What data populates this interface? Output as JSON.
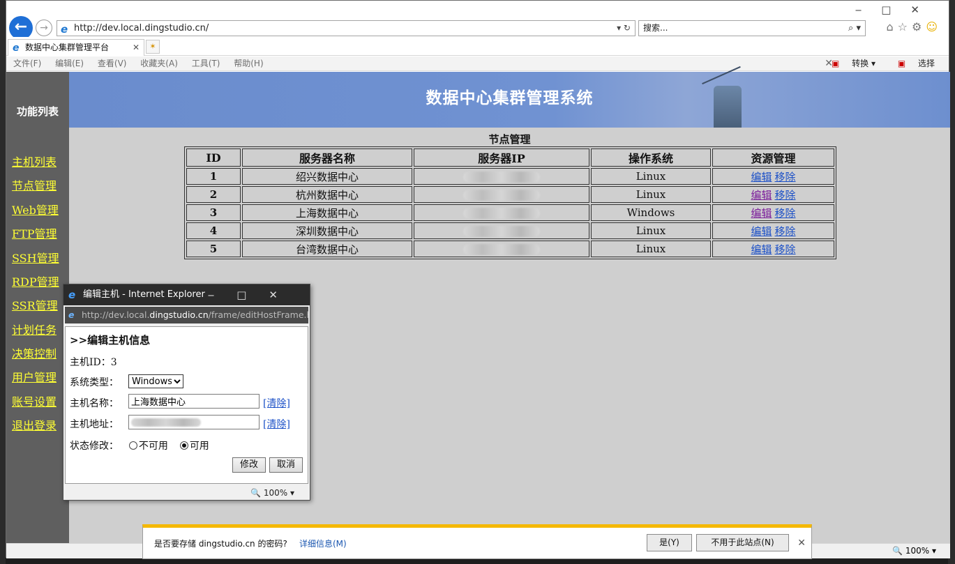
{
  "browser": {
    "url": "http://dev.local.dingstudio.cn/",
    "search_placeholder": "搜索...",
    "tab_title": "数据中心集群管理平台",
    "menu": [
      "文件(F)",
      "编辑(E)",
      "查看(V)",
      "收藏夹(A)",
      "工具(T)",
      "帮助(H)"
    ],
    "tools": [
      "转换",
      "选择"
    ],
    "zoom": "100%"
  },
  "sidebar": {
    "caption": "功能列表",
    "links": [
      "主机列表",
      "节点管理",
      "Web管理",
      "FTP管理",
      "SSH管理",
      "RDP管理",
      "SSR管理",
      "计划任务",
      "决策控制",
      "用户管理",
      "账号设置",
      "退出登录"
    ]
  },
  "banner": {
    "title": "数据中心集群管理系统"
  },
  "nodes": {
    "title": "节点管理",
    "headers": [
      "ID",
      "服务器名称",
      "服务器IP",
      "操作系统",
      "资源管理"
    ],
    "rows": [
      {
        "id": "1",
        "name": "绍兴数据中心",
        "os": "Linux"
      },
      {
        "id": "2",
        "name": "杭州数据中心",
        "os": "Linux"
      },
      {
        "id": "3",
        "name": "上海数据中心",
        "os": "Windows"
      },
      {
        "id": "4",
        "name": "深圳数据中心",
        "os": "Linux"
      },
      {
        "id": "5",
        "name": "台湾数据中心",
        "os": "Linux"
      }
    ],
    "edit_label": "编辑",
    "remove_label": "移除"
  },
  "dialog": {
    "window_title": "编辑主机 - Internet Explorer",
    "url_prefix": "http://dev.local.",
    "url_domain": "dingstudio.cn",
    "url_path": "/frame/editHostFrame.htm",
    "heading": ">>编辑主机信息",
    "host_id_label": "主机ID：",
    "host_id": "3",
    "os_label": "系统类型：",
    "os_value": "Windows",
    "name_label": "主机名称：",
    "name_value": "上海数据中心",
    "addr_label": "主机地址：",
    "clear_label": "[清除]",
    "status_label": "状态修改：",
    "status_unavailable": "不可用",
    "status_available": "可用",
    "submit_label": "修改",
    "cancel_label": "取消",
    "zoom": "100%"
  },
  "password_bar": {
    "message": "是否要存储 dingstudio.cn 的密码?",
    "more": "详细信息(M)",
    "yes": "是(Y)",
    "never": "不用于此站点(N)"
  }
}
